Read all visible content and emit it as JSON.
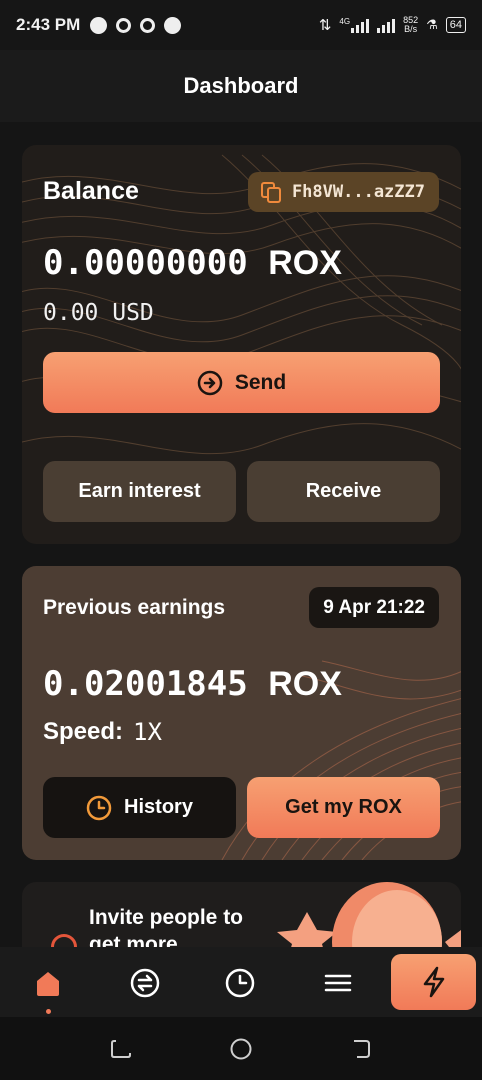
{
  "status_bar": {
    "time": "2:43 PM",
    "network": "4G",
    "net_speed_value": "852",
    "net_speed_unit": "B/s",
    "battery": "64"
  },
  "header": {
    "title": "Dashboard"
  },
  "balance_card": {
    "label": "Balance",
    "address": "Fh8VW...azZZ7",
    "amount": "0.00000000",
    "unit": "ROX",
    "usd": "0.00 USD",
    "send_label": "Send",
    "earn_interest_label": "Earn interest",
    "receive_label": "Receive"
  },
  "earnings_card": {
    "label": "Previous earnings",
    "date": "9 Apr 21:22",
    "amount": "0.02001845",
    "unit": "ROX",
    "speed_label": "Speed:",
    "speed_value": "1X",
    "history_label": "History",
    "get_rox_label": "Get my ROX"
  },
  "invite_card": {
    "text": "Invite people to get more"
  },
  "bottom_nav": {
    "items": [
      "home",
      "exchange",
      "history",
      "menu",
      "boost"
    ],
    "active": "home"
  },
  "colors": {
    "accent": "#f17a58",
    "accent_light": "#f7a072",
    "background": "#151515",
    "card_dark": "#211d1a",
    "card_brown": "#4c3d33"
  }
}
